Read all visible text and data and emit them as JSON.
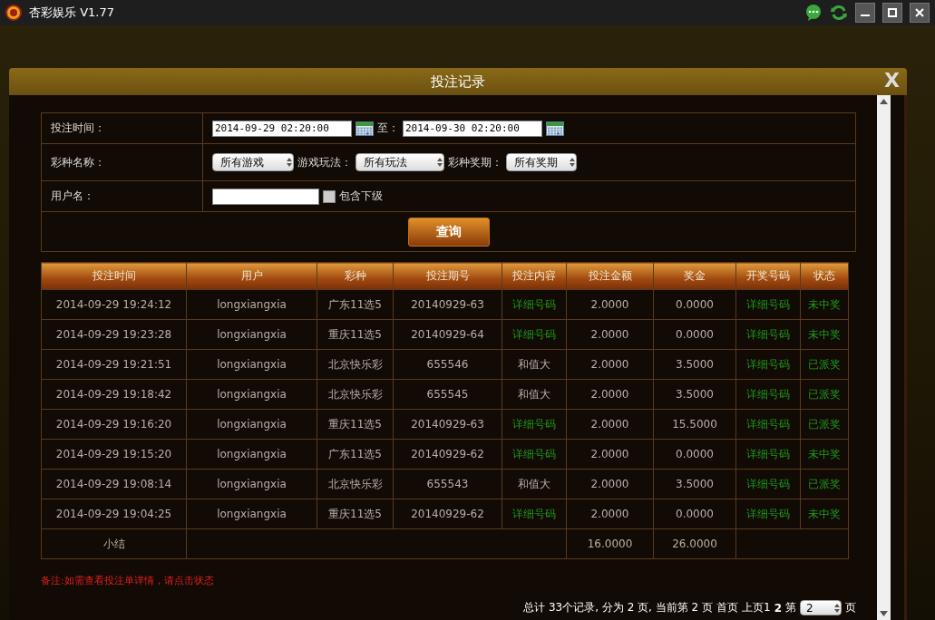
{
  "app": {
    "title": "杏彩娱乐 V1.77"
  },
  "dialog": {
    "title": "投注记录",
    "close": "X"
  },
  "filters": [
    {
      "kind": "date_range",
      "label": "投注时间：",
      "from": "2014-09-29 02:20:00",
      "separator": "至：",
      "to": "2014-09-30 02:20:00"
    },
    {
      "kind": "selects",
      "label": "彩种名称：",
      "selects": [
        {
          "value": "所有游戏"
        },
        {
          "label": "游戏玩法：",
          "value": "所有玩法"
        },
        {
          "label": "彩种奖期：",
          "value": "所有奖期"
        }
      ]
    },
    {
      "kind": "user",
      "label": "用户名：",
      "checkbox": {
        "label": "包含下级",
        "checked": false
      }
    }
  ],
  "search_button": "查询",
  "table": {
    "columns": [
      "投注时间",
      "用户",
      "彩种",
      "投注期号",
      "投注内容",
      "投注金额",
      "奖金",
      "开奖号码",
      "状态"
    ],
    "rows": [
      {
        "cells": [
          {
            "text": "2014-09-29 19:24:12"
          },
          {
            "text": "longxiangxia"
          },
          {
            "text": "广东11选5"
          },
          {
            "text": "20140929-63"
          },
          {
            "text": "详细号码",
            "kind": "link"
          },
          {
            "text": "2.0000"
          },
          {
            "text": "0.0000"
          },
          {
            "text": "详细号码",
            "kind": "link"
          },
          {
            "text": "未中奖",
            "kind": "link"
          }
        ]
      },
      {
        "cells": [
          {
            "text": "2014-09-29 19:23:28"
          },
          {
            "text": "longxiangxia"
          },
          {
            "text": "重庆11选5"
          },
          {
            "text": "20140929-64"
          },
          {
            "text": "详细号码",
            "kind": "link"
          },
          {
            "text": "2.0000"
          },
          {
            "text": "0.0000"
          },
          {
            "text": "详细号码",
            "kind": "link"
          },
          {
            "text": "未中奖",
            "kind": "link"
          }
        ]
      },
      {
        "cells": [
          {
            "text": "2014-09-29 19:21:51"
          },
          {
            "text": "longxiangxia"
          },
          {
            "text": "北京快乐彩"
          },
          {
            "text": "655546"
          },
          {
            "text": "和值大"
          },
          {
            "text": "2.0000"
          },
          {
            "text": "3.5000"
          },
          {
            "text": "详细号码",
            "kind": "link"
          },
          {
            "text": "已派奖",
            "kind": "link"
          }
        ]
      },
      {
        "cells": [
          {
            "text": "2014-09-29 19:18:42"
          },
          {
            "text": "longxiangxia"
          },
          {
            "text": "北京快乐彩"
          },
          {
            "text": "655545"
          },
          {
            "text": "和值大"
          },
          {
            "text": "2.0000"
          },
          {
            "text": "3.5000"
          },
          {
            "text": "详细号码",
            "kind": "link"
          },
          {
            "text": "已派奖",
            "kind": "link"
          }
        ]
      },
      {
        "cells": [
          {
            "text": "2014-09-29 19:16:20"
          },
          {
            "text": "longxiangxia"
          },
          {
            "text": "重庆11选5"
          },
          {
            "text": "20140929-63"
          },
          {
            "text": "详细号码",
            "kind": "link"
          },
          {
            "text": "2.0000"
          },
          {
            "text": "15.5000"
          },
          {
            "text": "详细号码",
            "kind": "link"
          },
          {
            "text": "已派奖",
            "kind": "link"
          }
        ]
      },
      {
        "cells": [
          {
            "text": "2014-09-29 19:15:20"
          },
          {
            "text": "longxiangxia"
          },
          {
            "text": "广东11选5"
          },
          {
            "text": "20140929-62"
          },
          {
            "text": "详细号码",
            "kind": "link"
          },
          {
            "text": "2.0000"
          },
          {
            "text": "0.0000"
          },
          {
            "text": "详细号码",
            "kind": "link"
          },
          {
            "text": "未中奖",
            "kind": "link"
          }
        ]
      },
      {
        "cells": [
          {
            "text": "2014-09-29 19:08:14"
          },
          {
            "text": "longxiangxia"
          },
          {
            "text": "北京快乐彩"
          },
          {
            "text": "655543"
          },
          {
            "text": "和值大"
          },
          {
            "text": "2.0000"
          },
          {
            "text": "3.5000"
          },
          {
            "text": "详细号码",
            "kind": "link"
          },
          {
            "text": "已派奖",
            "kind": "link"
          }
        ]
      },
      {
        "cells": [
          {
            "text": "2014-09-29 19:04:25"
          },
          {
            "text": "longxiangxia"
          },
          {
            "text": "重庆11选5"
          },
          {
            "text": "20140929-62"
          },
          {
            "text": "详细号码",
            "kind": "link"
          },
          {
            "text": "2.0000"
          },
          {
            "text": "0.0000"
          },
          {
            "text": "详细号码",
            "kind": "link"
          },
          {
            "text": "未中奖",
            "kind": "link"
          }
        ]
      }
    ],
    "subtotal": {
      "label": "小结",
      "amount": "16.0000",
      "prize": "26.0000"
    }
  },
  "note": "备注:如需查看投注单详情，请点击状态",
  "pagination": {
    "summary": "总计 33个记录, 分为 2 页, 当前第 2 页",
    "links": [
      "首页",
      "上页1"
    ],
    "current": "2",
    "prefix": "第",
    "page": "2",
    "suffix": "页"
  }
}
